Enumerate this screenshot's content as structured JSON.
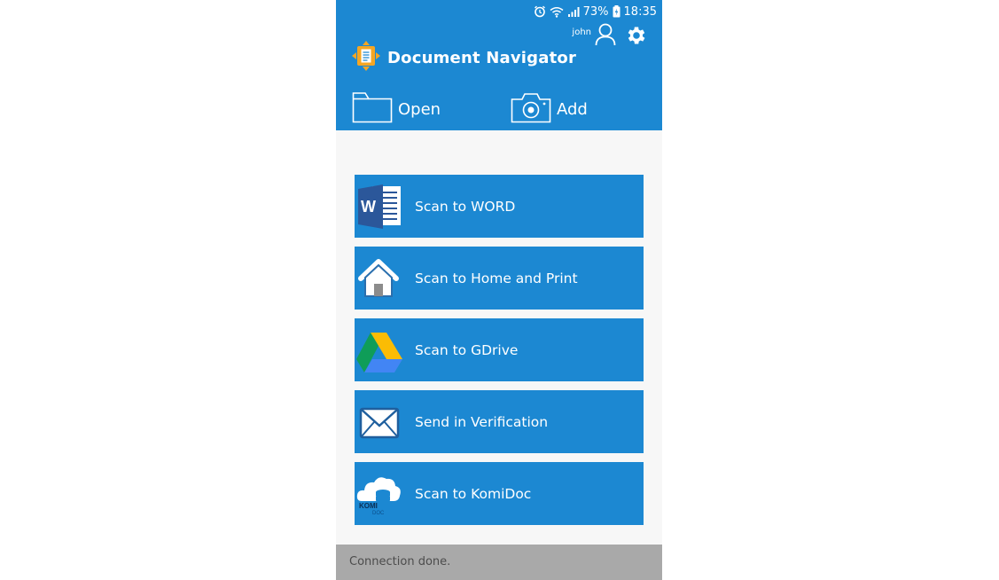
{
  "status_bar": {
    "battery": "73%",
    "time": "18:35",
    "icons": [
      "alarm-icon",
      "wifi-icon",
      "signal-icon",
      "battery-charging-icon"
    ]
  },
  "header": {
    "title": "Document Navigator",
    "user": "john",
    "icons": [
      "app-logo-icon",
      "user-icon",
      "gear-icon"
    ]
  },
  "actions": {
    "open_label": "Open",
    "add_label": "Add",
    "open_icon": "folder-icon",
    "add_icon": "camera-icon"
  },
  "menu": {
    "items": [
      {
        "label": "Scan to WORD",
        "icon": "word-icon"
      },
      {
        "label": "Scan to Home and Print",
        "icon": "home-icon"
      },
      {
        "label": "Scan to GDrive",
        "icon": "gdrive-icon"
      },
      {
        "label": "Send in Verification",
        "icon": "envelope-icon"
      },
      {
        "label": "Scan to KomiDoc",
        "icon": "komidoc-icon"
      }
    ],
    "komidoc_icon_text": "KOMI",
    "komidoc_icon_sub": "DOC"
  },
  "footer": {
    "status": "Connection done."
  },
  "colors": {
    "primary": "#1c88d2",
    "background": "#f7f7f7",
    "footer": "#a9a9a9",
    "footer_text": "#4c4c4c"
  }
}
